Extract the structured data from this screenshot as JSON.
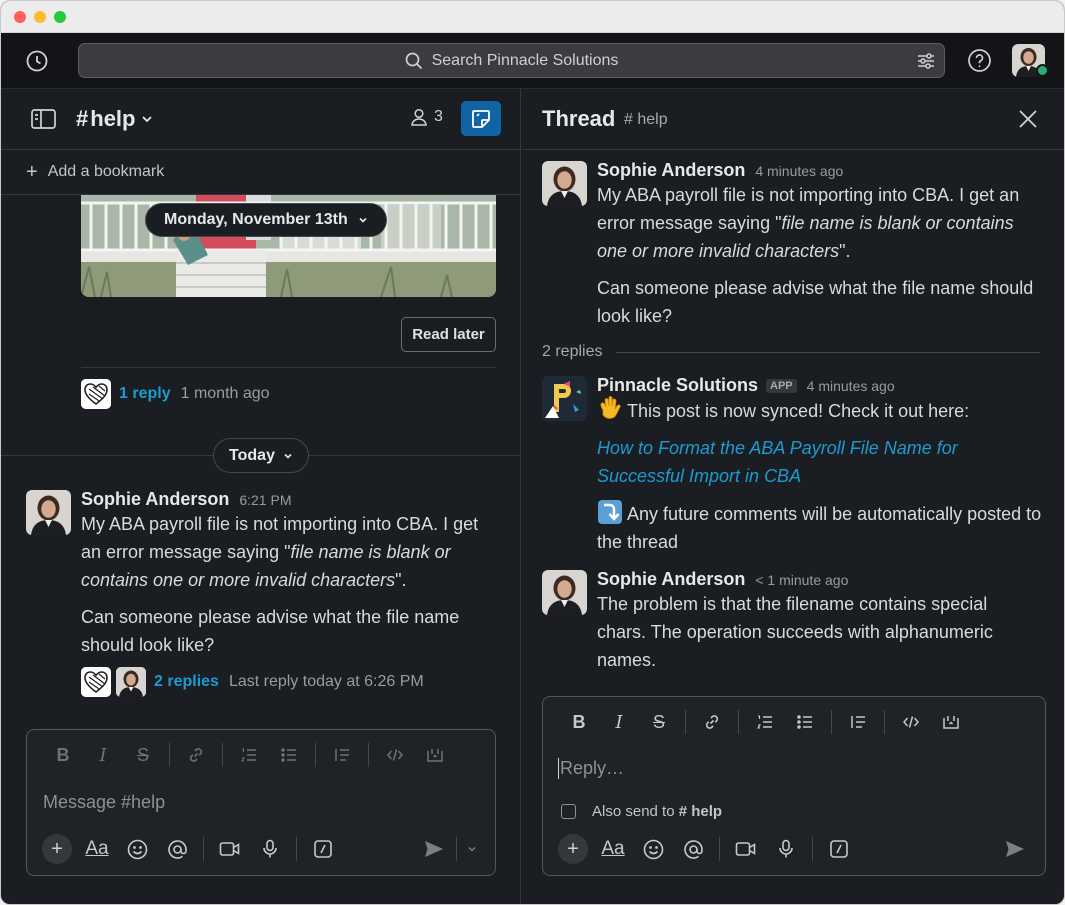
{
  "search": {
    "placeholder": "Search Pinnacle Solutions"
  },
  "channel": {
    "name": "help",
    "hash": "#",
    "members_count": "3"
  },
  "bookmark": {
    "label": "Add a bookmark"
  },
  "history": {
    "date_label": "Monday, November 13th",
    "read_later_label": "Read later",
    "reply_link": "1 reply",
    "reply_time": "1 month ago"
  },
  "divider": {
    "today_label": "Today"
  },
  "channel_message": {
    "author": "Sophie Anderson",
    "time": "6:21 PM",
    "p1_start": "My ABA payroll file is not importing into CBA. I get an error message saying \"",
    "p1_italic": "file name is blank or contains one or more invalid characters",
    "p1_end": "\".",
    "p2": "Can someone please advise what the file name should look like?",
    "replies_link": "2 replies",
    "last_reply": "Last reply today at 6:26 PM"
  },
  "composer": {
    "placeholder": "Message #help"
  },
  "thread": {
    "title": "Thread",
    "channel": "# help",
    "parent": {
      "author": "Sophie Anderson",
      "time": "4 minutes ago",
      "p1_start": "My ABA payroll file is not importing into CBA. I get an error message saying \"",
      "p1_italic": "file name is blank or contains one or more invalid characters",
      "p1_end": "\".",
      "p2": "Can someone please advise what the file name should look like?"
    },
    "replies_count_label": "2 replies",
    "bot_reply": {
      "author": "Pinnacle Solutions",
      "badge": "APP",
      "time": "4 minutes ago",
      "line1": "This post is now synced! Check it out here:",
      "link": "How to Format the ABA Payroll File Name for Successful Import in CBA",
      "line2": "Any future comments will be automatically posted to the thread"
    },
    "user_reply": {
      "author": "Sophie Anderson",
      "time": "< 1 minute ago",
      "text": "The problem is that the filename contains special chars. The operation succeeds with alphanumeric names."
    },
    "reply_placeholder": "Reply…",
    "also_send_label": "Also send to",
    "also_send_channel": "# help"
  },
  "colors": {
    "accent": "#1164a3",
    "link": "#1d9bd1",
    "presence": "#2bac76",
    "background": "#1a1d21"
  }
}
